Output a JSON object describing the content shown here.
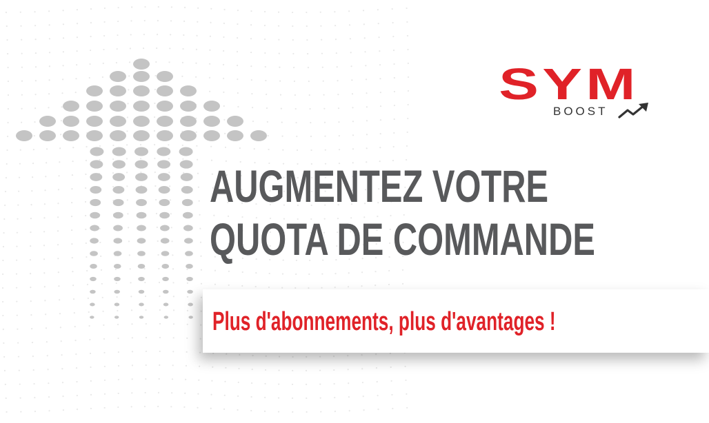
{
  "logo": {
    "main_text": "SYM",
    "sub_text": "BOOST",
    "arrow_icon": "trend-up-arrow-icon",
    "brand_color": "#e02228",
    "sub_color": "#333333"
  },
  "headline": {
    "line1": "AUGMENTEZ VOTRE",
    "line2": "QUOTA DE COMMANDE",
    "color": "#58595b"
  },
  "banner": {
    "text": "Plus d'abonnements, plus d'avantages !",
    "color": "#e02228"
  },
  "background": {
    "icon": "dotted-up-arrow-icon",
    "dot_color": "#c4c4c4"
  }
}
